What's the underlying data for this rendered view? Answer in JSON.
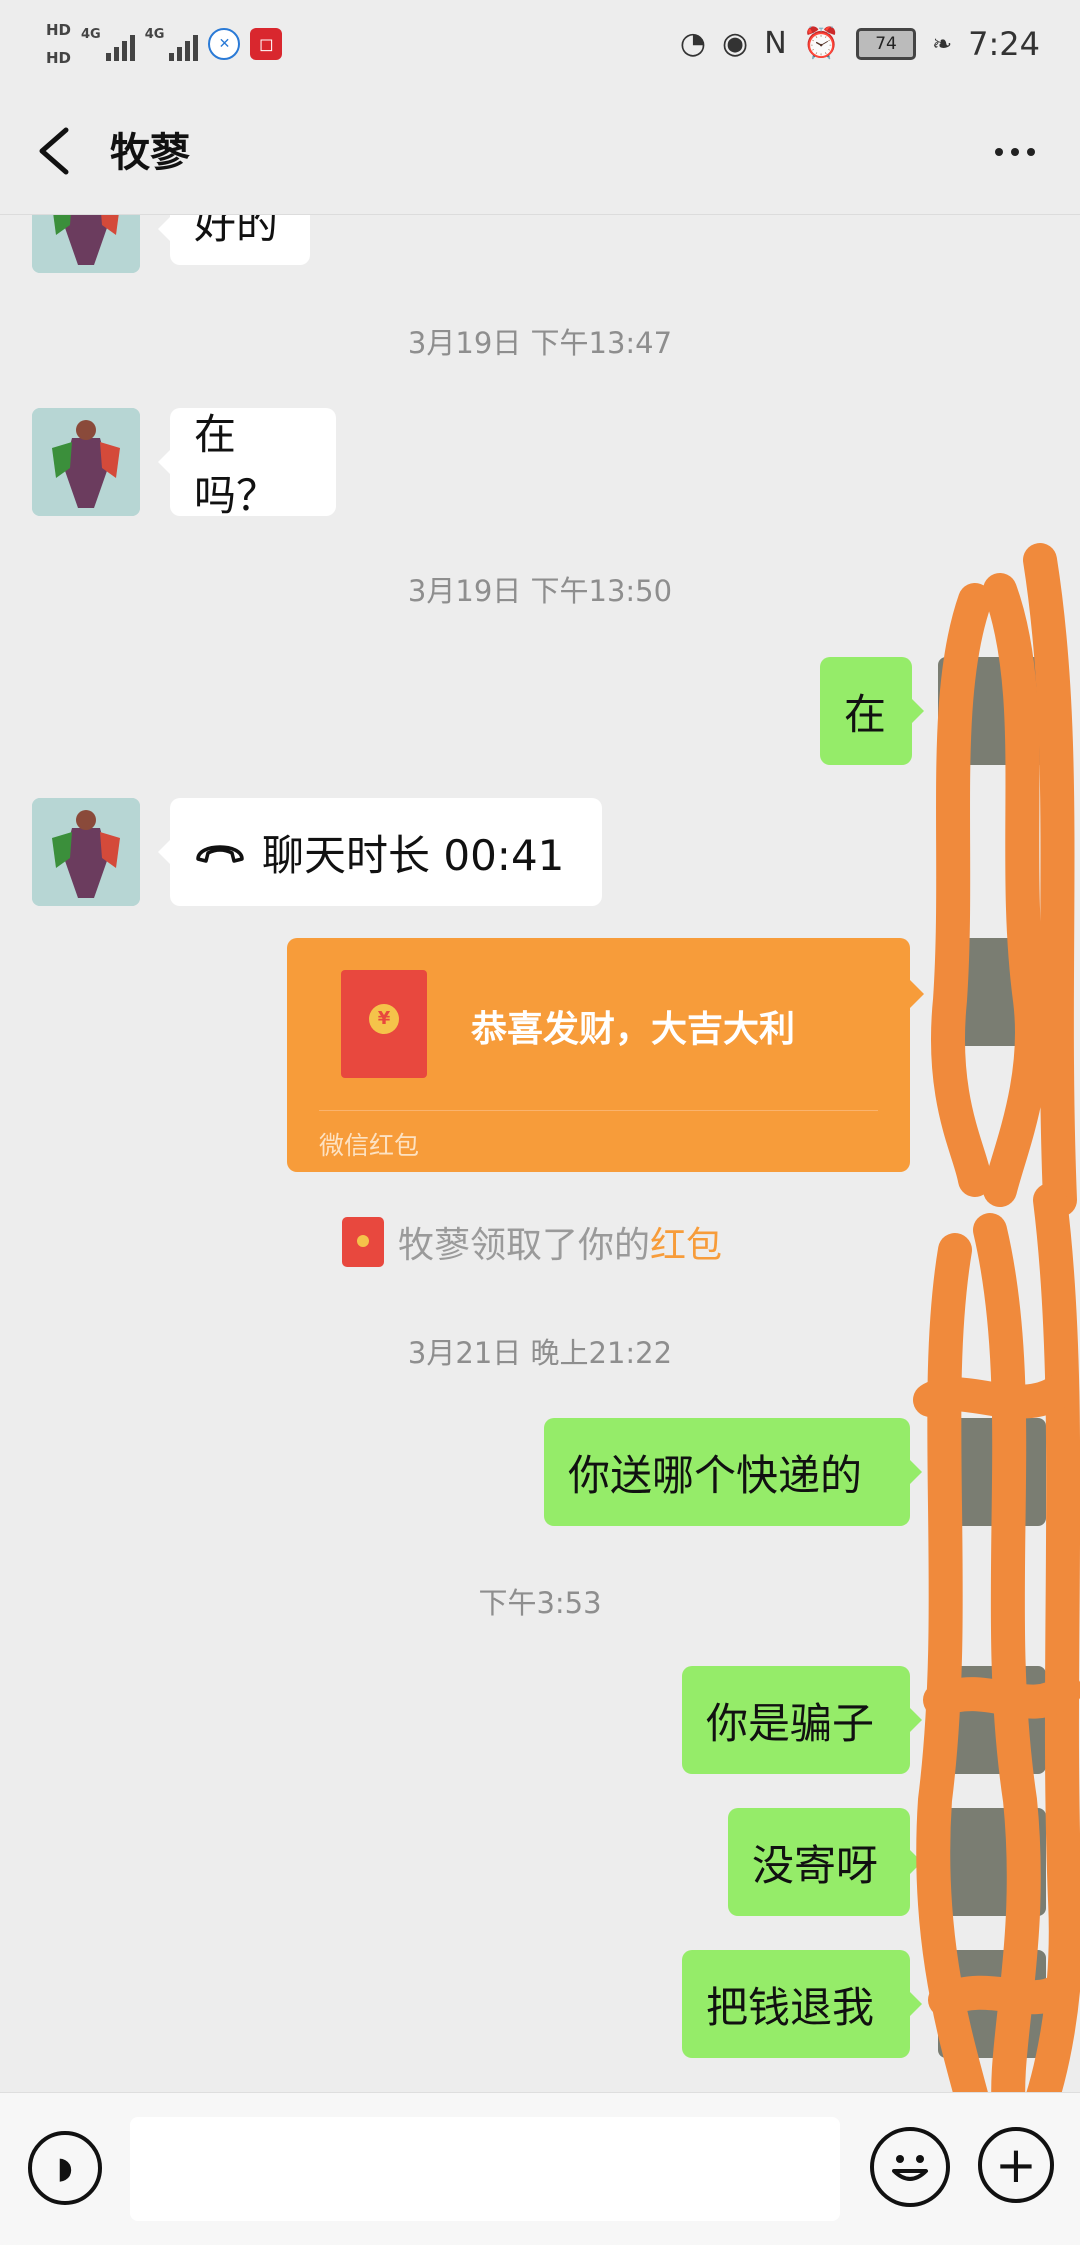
{
  "status_bar": {
    "hd1": "HD",
    "hd2": "HD",
    "net1": "4G",
    "net2": "4G",
    "battery": "74",
    "time": "7:24"
  },
  "header": {
    "title": "牧蓼"
  },
  "messages": {
    "m0_text": "好的",
    "ts1": "3月19日 下午13:47",
    "m1_text": "在吗？",
    "ts2": "3月19日 下午13:50",
    "m2_text": "在",
    "m3_call": "聊天时长 00:41",
    "rp_greeting": "恭喜发财，大吉大利",
    "rp_label": "微信红包",
    "sys_prefix": "牧蓼领取了你的",
    "sys_link": "红包",
    "ts3": "3月21日 晚上21:22",
    "m4_text": "你送哪个快递的",
    "ts4": "下午3:53",
    "m5_text": "你是骗子",
    "m6_text": "没寄呀",
    "m7_text": "把钱退我"
  },
  "colors": {
    "background": "#ededed",
    "outgoing_bubble": "#95ec69",
    "incoming_bubble": "#ffffff",
    "red_packet": "#f79c3a",
    "scribble": "#f08a3c"
  },
  "icons": {
    "back": "chevron-left-icon",
    "more": "more-dots-icon",
    "voice": "voice-icon",
    "emoji": "emoji-icon",
    "plus": "plus-icon",
    "call": "phone-icon"
  }
}
